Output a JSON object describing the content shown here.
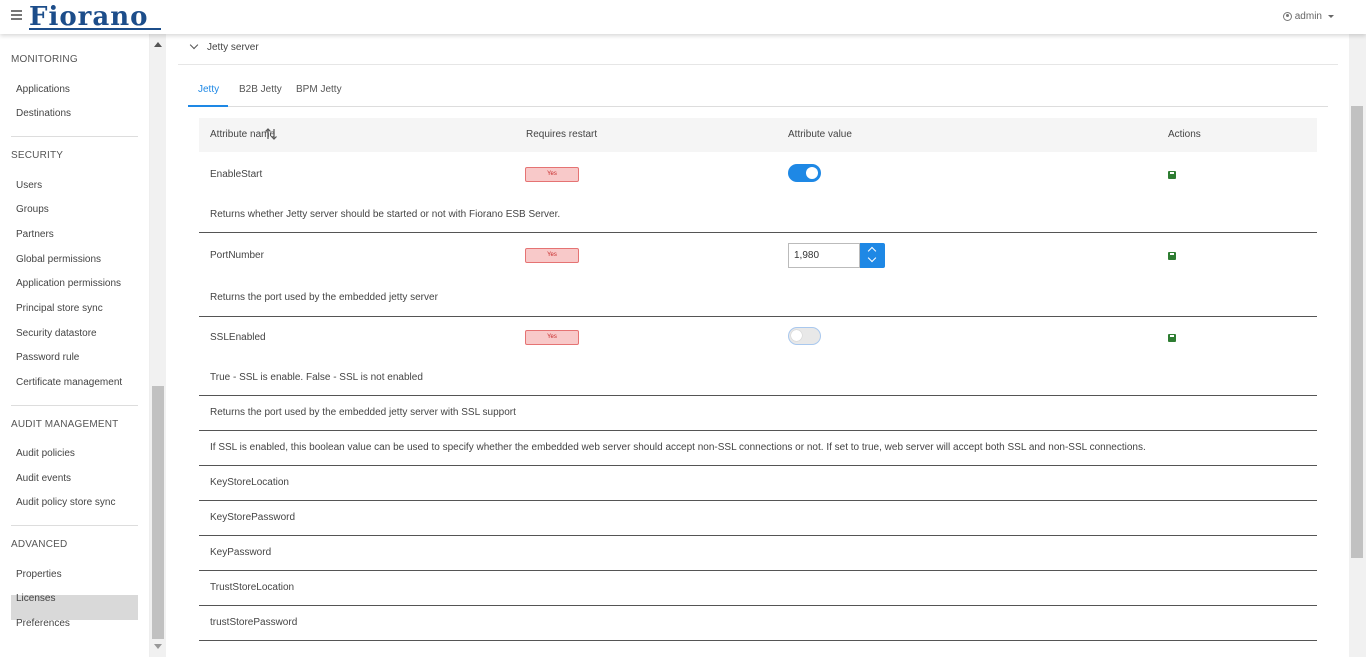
{
  "header": {
    "logo": "Fiorano",
    "user": "admin"
  },
  "sidebar": {
    "sections": [
      {
        "title": "MONITORING",
        "items": [
          "Applications",
          "Destinations"
        ]
      },
      {
        "title": "SECURITY",
        "items": [
          "Users",
          "Groups",
          "Partners",
          "Global permissions",
          "Application permissions",
          "Principal store sync",
          "Security datastore",
          "Password rule",
          "Certificate management"
        ]
      },
      {
        "title": "AUDIT MANAGEMENT",
        "items": [
          "Audit policies",
          "Audit events",
          "Audit policy store sync"
        ]
      },
      {
        "title": "ADVANCED",
        "items": [
          "Properties",
          "Licenses",
          "Preferences"
        ]
      }
    ],
    "active_item": "Properties"
  },
  "panel": {
    "title": "Jetty server"
  },
  "tabs": [
    {
      "label": "Jetty",
      "active": true
    },
    {
      "label": "B2B Jetty",
      "active": false
    },
    {
      "label": "BPM Jetty",
      "active": false
    }
  ],
  "table": {
    "headers": [
      "Attribute name",
      "Requires restart",
      "Attribute value",
      "Actions"
    ],
    "rows": [
      {
        "name": "EnableStart",
        "requires_restart": "Yes",
        "value_type": "toggle",
        "value": true,
        "description": "Returns whether Jetty server should be started or not with Fiorano ESB Server."
      },
      {
        "name": "PortNumber",
        "requires_restart": "Yes",
        "value_type": "number",
        "value": "1,980",
        "description": "Returns the port used by the embedded jetty server"
      },
      {
        "name": "SSLEnabled",
        "requires_restart": "Yes",
        "value_type": "toggle",
        "value": false,
        "description": "True - SSL is enable. False - SSL is not enabled"
      }
    ],
    "extra_rows": [
      "Returns the port used by the embedded jetty server with SSL support",
      "If SSL is enabled, this boolean value can be used to specify whether the embedded web server should accept non-SSL connections or not. If set to true, web server will accept both SSL and non-SSL connections.",
      "KeyStoreLocation",
      "KeyStorePassword",
      "KeyPassword",
      "TrustStoreLocation",
      "trustStorePassword"
    ]
  },
  "colors": {
    "accent": "#1e88e5",
    "badge_bg": "#f8c9c9",
    "badge_border": "#e57373",
    "save_icon": "#2e7d32",
    "logo": "#1c4d8a"
  }
}
